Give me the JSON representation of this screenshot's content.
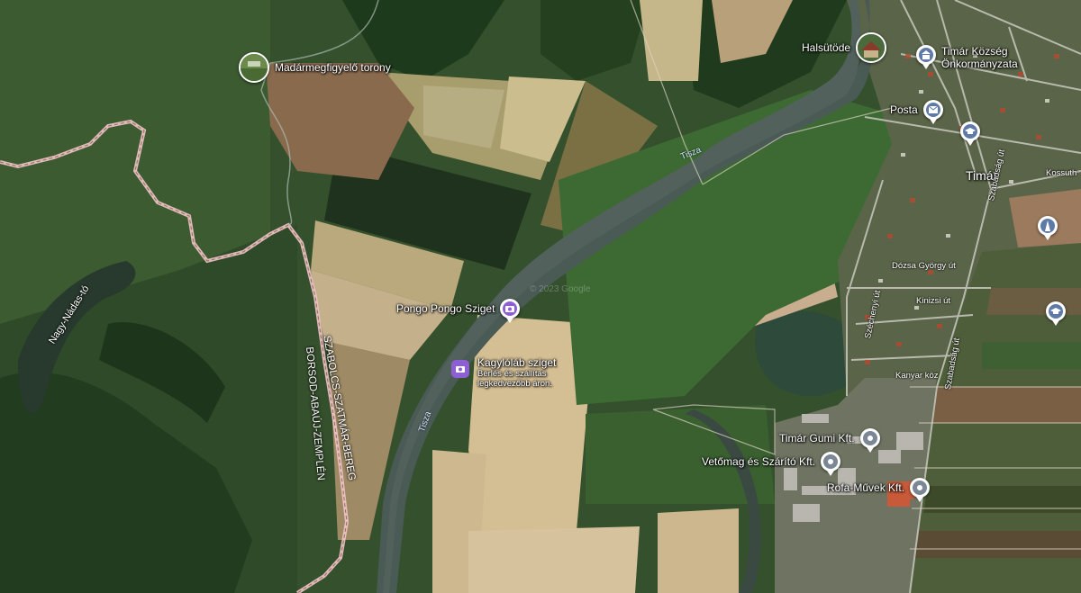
{
  "map": {
    "watermark": "© 2023 Google",
    "colors": {
      "water": "#4a5a55",
      "field_light": "#c9b489",
      "field_green": "#4d6a35",
      "forest": "#1f3a1c",
      "border": "#f2c4c4",
      "poi_purple": "#8d5ed4",
      "poi_blue": "#5e7aa8"
    },
    "pois": [
      {
        "label": "Madármegfigyelő torony",
        "icon": "photo-icon"
      },
      {
        "label": "Halsütöde",
        "icon": "photo-icon"
      },
      {
        "label": "Timár Község Önkormányzata",
        "icon": "town-hall-icon"
      },
      {
        "label": "Posta",
        "icon": "mail-icon"
      },
      {
        "label": "Pongo Pongo Sziget",
        "icon": "camera-icon"
      },
      {
        "label": "Kagylóláb sziget",
        "sub1": "Bérlés és szállítás",
        "sub2": "legkedvezőbb áron.",
        "icon": "camera-icon"
      },
      {
        "label": "Timár Gumi Kft.",
        "icon": "pin-icon"
      },
      {
        "label": "Vetőmag és Szárító Kft.",
        "icon": "pin-icon"
      },
      {
        "label": "Rofa-Művek Kft.",
        "icon": "pin-icon"
      }
    ],
    "places": {
      "town": "Timár",
      "lake": "Nagy-Nádas-tó",
      "county_north": "SZABOLCS-SZATMÁR-BEREG",
      "county_south": "BORSOD-ABAÚJ-ZEMPLÉN",
      "river_upper": "Tisza",
      "river_lower": "Tisza"
    },
    "streets": {
      "dozsa": "Dózsa György út",
      "kinizsi": "Kinizsi út",
      "kanyar": "Kanyar köz",
      "szabadsag1": "Szabadság út",
      "szabadsag2": "Szabadság út",
      "szechenyi": "Széchenyi út",
      "kossuth": "Kossuth"
    }
  }
}
